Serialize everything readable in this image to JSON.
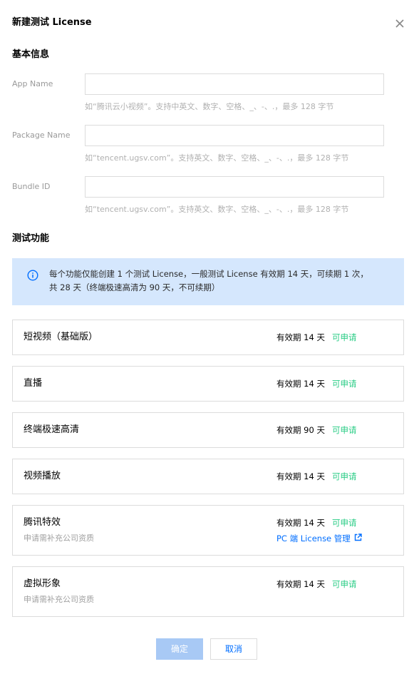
{
  "dialog": {
    "title": "新建测试 License"
  },
  "basic_info": {
    "title": "基本信息",
    "fields": [
      {
        "label": "App Name",
        "value": "",
        "placeholder": "",
        "hint": "如“腾讯云小视频”。支持中英文、数字、空格、_、-、.，最多 128 字节"
      },
      {
        "label": "Package Name",
        "value": "",
        "placeholder": "",
        "hint": "如“tencent.ugsv.com”。支持英文、数字、空格、_、-、.，最多 128 字节"
      },
      {
        "label": "Bundle ID",
        "value": "",
        "placeholder": "",
        "hint": "如“tencent.ugsv.com”。支持英文、数字、空格、_、-、.，最多 128 字节"
      }
    ]
  },
  "test_features": {
    "title": "测试功能",
    "notice": {
      "icon": "info-icon",
      "line1": "每个功能仅能创建 1 个测试 License，一般测试 License 有效期 14 天，可续期 1 次，",
      "line2": "共 28 天（终端极速高清为 90 天，不可续期）"
    },
    "items": [
      {
        "name": "短视频（基础版）",
        "validity": "有效期 14 天",
        "status": "可申请",
        "note": "",
        "link": ""
      },
      {
        "name": "直播",
        "validity": "有效期 14 天",
        "status": "可申请",
        "note": "",
        "link": ""
      },
      {
        "name": "终端极速高清",
        "validity": "有效期 90 天",
        "status": "可申请",
        "note": "",
        "link": ""
      },
      {
        "name": "视频播放",
        "validity": "有效期 14 天",
        "status": "可申请",
        "note": "",
        "link": ""
      },
      {
        "name": "腾讯特效",
        "validity": "有效期 14 天",
        "status": "可申请",
        "note": "申请需补充公司资质",
        "link": "PC 端 License 管理"
      },
      {
        "name": "虚拟形象",
        "validity": "有效期 14 天",
        "status": "可申请",
        "note": "申请需补充公司资质",
        "link": ""
      }
    ]
  },
  "footer": {
    "confirm_label": "确定",
    "cancel_label": "取消"
  },
  "colors": {
    "accent": "#006eff",
    "status_ok": "#29cc85",
    "notice_bg": "#d5e7fd",
    "confirm_disabled": "#a8c9f5"
  }
}
